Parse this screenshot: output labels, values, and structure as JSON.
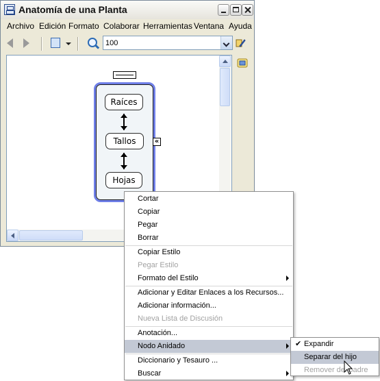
{
  "window": {
    "title": "Anatomía de una Planta"
  },
  "menubar": [
    "Archivo",
    "Edición",
    "Formato",
    "Colaborar",
    "Herramientas",
    "Ventana",
    "Ayuda"
  ],
  "toolbar": {
    "zoom_value": "100",
    "icons": [
      "back-arrow-icon",
      "forward-arrow-icon",
      "view-mode-icon",
      "zoom-icon",
      "style-palette-icon",
      "info-panel-icon"
    ]
  },
  "concept_map": {
    "nodes": [
      "Raíces",
      "Tallos",
      "Hojas"
    ]
  },
  "context_menu": {
    "items": [
      {
        "label": "Cortar",
        "enabled": true
      },
      {
        "label": "Copiar",
        "enabled": true
      },
      {
        "label": "Pegar",
        "enabled": true
      },
      {
        "label": "Borrar",
        "enabled": true
      },
      {
        "label": "Copiar Estilo",
        "enabled": true
      },
      {
        "label": "Pegar Estilo",
        "enabled": false
      },
      {
        "label": "Formato del Estilo",
        "enabled": true,
        "submenu": true
      },
      {
        "label": "Adicionar y Editar Enlaces a los Recursos...",
        "enabled": true
      },
      {
        "label": "Adicionar información...",
        "enabled": true
      },
      {
        "label": "Nueva Lista de Discusión",
        "enabled": false
      },
      {
        "label": "Anotación...",
        "enabled": true
      },
      {
        "label": "Nodo Anidado",
        "enabled": true,
        "submenu": true,
        "highlighted": true
      },
      {
        "label": "Diccionario y Tesauro ...",
        "enabled": true
      },
      {
        "label": "Buscar",
        "enabled": true,
        "submenu": true
      }
    ]
  },
  "submenu": {
    "items": [
      {
        "label": "Expandir",
        "checked": true,
        "enabled": true
      },
      {
        "label": "Separar del hijo",
        "enabled": true,
        "highlighted": true
      },
      {
        "label": "Remover del padre",
        "enabled": false
      }
    ]
  },
  "colors": {
    "container_border": "#6f7fe8",
    "menu_highlight": "#c3c9d5",
    "disabled_text": "#a2a2a2"
  }
}
